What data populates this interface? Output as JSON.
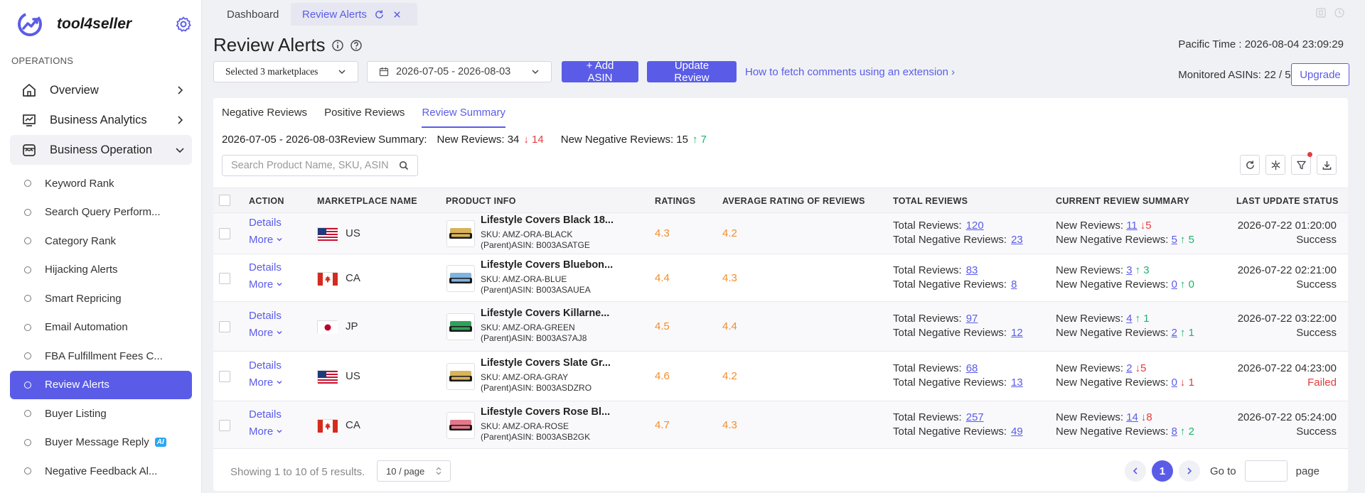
{
  "brand": {
    "name": "tool4seller"
  },
  "sidebar": {
    "section": "OPERATIONS",
    "main_items": [
      {
        "label": "Overview"
      },
      {
        "label": "Business Analytics"
      },
      {
        "label": "Business Operation"
      }
    ],
    "sub_items": [
      {
        "label": "Keyword Rank"
      },
      {
        "label": "Search Query Perform..."
      },
      {
        "label": "Category Rank"
      },
      {
        "label": "Hijacking Alerts"
      },
      {
        "label": "Smart Repricing"
      },
      {
        "label": "Email Automation"
      },
      {
        "label": "FBA Fulfillment Fees C..."
      },
      {
        "label": "Review Alerts"
      },
      {
        "label": "Buyer Listing"
      },
      {
        "label": "Buyer Message Reply",
        "badge": "AI"
      },
      {
        "label": "Negative Feedback Al..."
      }
    ]
  },
  "tabs": {
    "dashboard": "Dashboard",
    "active": "Review Alerts"
  },
  "header": {
    "title": "Review Alerts",
    "pacific_time_label": "Pacific Time :",
    "pacific_time": "2026-08-04 23:09:29",
    "marketplaces": "Selected 3 marketplaces",
    "date_range": "2026-07-05 - 2026-08-03",
    "add_asin": "+ Add ASIN",
    "update_review": "Update Review",
    "help_link": "How to fetch comments using an extension ›",
    "monitored": "Monitored ASINs: 22 / 50",
    "upgrade": "Upgrade"
  },
  "subtabs": [
    "Negative Reviews",
    "Positive Reviews",
    "Review Summary"
  ],
  "summary": {
    "range": "2026-07-05 - 2026-08-03",
    "label": "Review Summary:",
    "new_reviews": "New Reviews: 34",
    "new_reviews_delta": "↓ 14",
    "new_negative": "New Negative Reviews: 15",
    "new_negative_delta": "↑ 7"
  },
  "search": {
    "placeholder": "Search Product Name, SKU, ASIN"
  },
  "table": {
    "columns": [
      "ACTION",
      "MARKETPLACE NAME",
      "PRODUCT INFO",
      "RATINGS",
      "AVERAGE RATING OF REVIEWS",
      "TOTAL REVIEWS",
      "CURRENT REVIEW SUMMARY",
      "LAST UPDATE STATUS"
    ],
    "details_label": "Details",
    "more_label": "More",
    "total_reviews_label": "Total Reviews:",
    "total_negative_label": "Total Negative Reviews:",
    "new_reviews_label": "New Reviews:",
    "new_negative_label": "New Negative Reviews:",
    "rows": [
      {
        "flag": "us",
        "market": "US",
        "name": "Lifestyle Covers Black 18...",
        "sku": "SKU: AMZ-ORA-BLACK",
        "asin": "(Parent)ASIN: B003ASATGE",
        "rating": "4.3",
        "avg": "4.2",
        "total": "120",
        "total_neg": "23",
        "new": "11",
        "new_delta": "↓5",
        "new_delta_dir": "down",
        "new_neg": "5",
        "new_neg_delta": "↑ 5",
        "new_neg_dir": "up",
        "updated": "2026-07-22 01:20:00",
        "status": "Success",
        "thumb_color": "#d8b35a"
      },
      {
        "flag": "ca",
        "market": "CA",
        "name": "Lifestyle Covers Bluebon...",
        "sku": "SKU: AMZ-ORA-BLUE",
        "asin": "(Parent)ASIN: B003ASAUEA",
        "rating": "4.4",
        "avg": "4.3",
        "total": "83",
        "total_neg": "8",
        "new": "3",
        "new_delta": "↑ 3",
        "new_delta_dir": "up",
        "new_neg": "0",
        "new_neg_delta": "↑ 0",
        "new_neg_dir": "up",
        "updated": "2026-07-22 02:21:00",
        "status": "Success",
        "thumb_color": "#7fb3e0"
      },
      {
        "flag": "jp",
        "market": "JP",
        "name": "Lifestyle Covers Killarne...",
        "sku": "SKU: AMZ-ORA-GREEN",
        "asin": "(Parent)ASIN: B003AS7AJ8",
        "rating": "4.5",
        "avg": "4.4",
        "total": "97",
        "total_neg": "12",
        "new": "4",
        "new_delta": "↑ 1",
        "new_delta_dir": "up",
        "new_neg": "2",
        "new_neg_delta": "↑ 1",
        "new_neg_dir": "up",
        "updated": "2026-07-22 03:22:00",
        "status": "Success",
        "thumb_color": "#2fa15a"
      },
      {
        "flag": "us",
        "market": "US",
        "name": "Lifestyle Covers Slate Gr...",
        "sku": "SKU: AMZ-ORA-GRAY",
        "asin": "(Parent)ASIN: B003ASDZRO",
        "rating": "4.6",
        "avg": "4.2",
        "total": "68",
        "total_neg": "13",
        "new": "2",
        "new_delta": "↓5",
        "new_delta_dir": "down",
        "new_neg": "0",
        "new_neg_delta": "↓ 1",
        "new_neg_dir": "down",
        "updated": "2026-07-22 04:23:00",
        "status": "Failed",
        "thumb_color": "#d8b35a"
      },
      {
        "flag": "ca",
        "market": "CA",
        "name": "Lifestyle Covers Rose Bl...",
        "sku": "SKU: AMZ-ORA-ROSE",
        "asin": "(Parent)ASIN: B003ASB2GK",
        "rating": "4.7",
        "avg": "4.3",
        "total": "257",
        "total_neg": "49",
        "new": "14",
        "new_delta": "↓8",
        "new_delta_dir": "down",
        "new_neg": "8",
        "new_neg_delta": "↑ 2",
        "new_neg_dir": "up",
        "updated": "2026-07-22 05:24:00",
        "status": "Success",
        "thumb_color": "#e07a8a"
      }
    ]
  },
  "pagination": {
    "showing": "Showing 1 to 10 of 5 results.",
    "per_page": "10 / page",
    "current": "1",
    "goto_label": "Go to",
    "page_label": "page"
  },
  "colors": {
    "accent": "#5a5ce8",
    "rating": "#f28e2b",
    "down": "#e53b3b",
    "up": "#1db36b"
  }
}
